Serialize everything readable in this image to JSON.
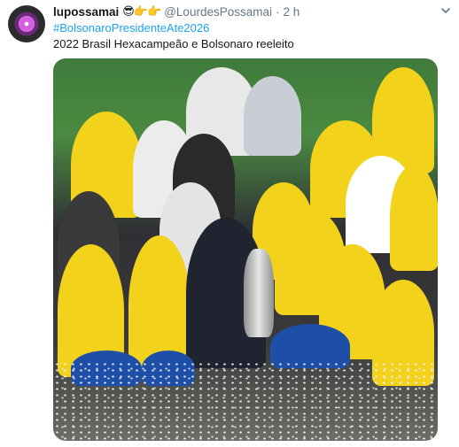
{
  "tweet": {
    "username": "lupossamai",
    "emojis": "😎👉👉",
    "handle": "@LourdesPossamai",
    "separator": "·",
    "time": "2 h",
    "hashtag": "#BolsonaroPresidenteAte2026",
    "text": "2022 Brasil Hexacampeão e Bolsonaro reeleito"
  },
  "icons": {
    "avatar": "flower-avatar-icon",
    "menu": "chevron-down-icon"
  },
  "colors": {
    "link": "#1da1f2",
    "secondary_text": "#657786",
    "jersey_yellow": "#f2d21b",
    "shorts_blue": "#1d4fa8"
  }
}
